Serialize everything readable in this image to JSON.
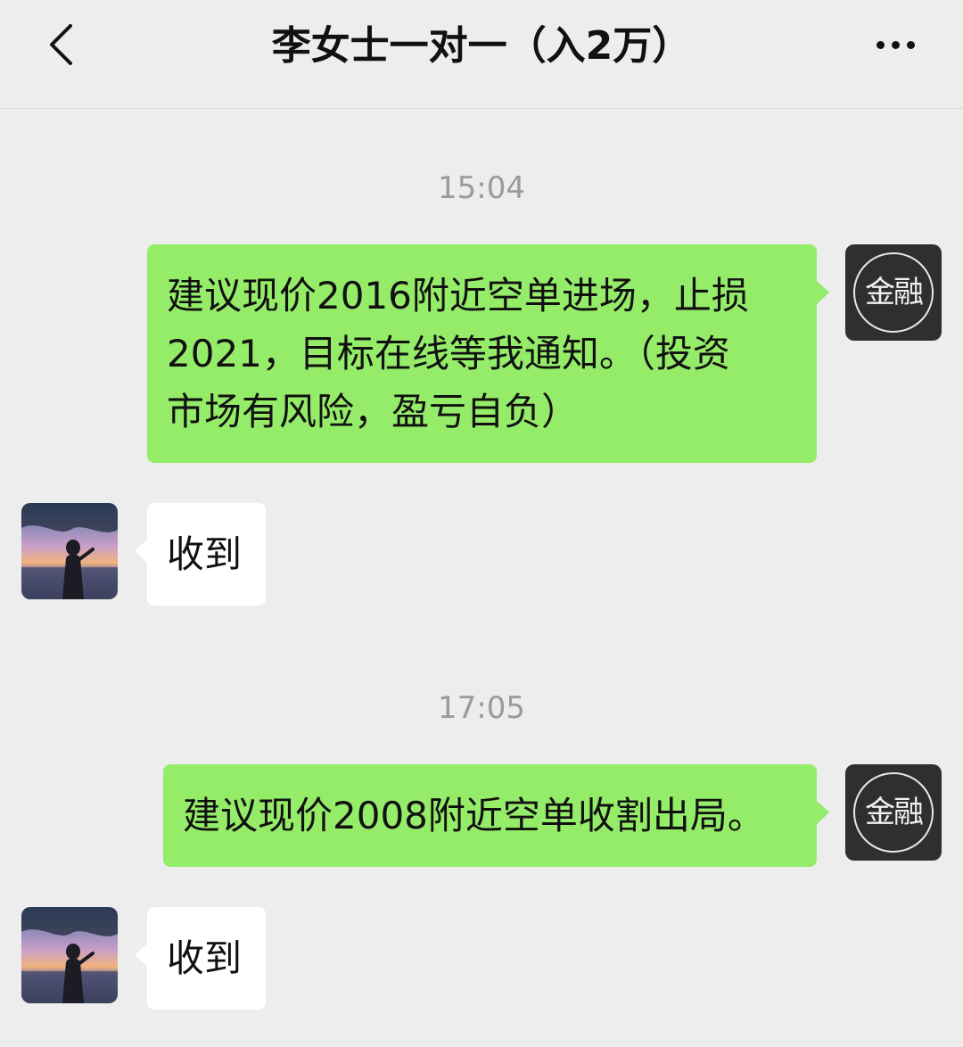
{
  "header": {
    "title": "李女士一对一（入2万）"
  },
  "colors": {
    "background": "#ededed",
    "sent_bubble": "#95ec69",
    "received_bubble": "#ffffff",
    "timestamp": "#9a9a9a"
  },
  "avatars": {
    "self_label": "金融",
    "other_icon": "sunset-silhouette-photo"
  },
  "messages": [
    {
      "time": "15:04"
    },
    {
      "direction": "sent",
      "text": "建议现价2016附近空单进场，止损\n2021，目标在线等我通知。（投资\n市场有风险，盈亏自负）"
    },
    {
      "direction": "received",
      "text": "收到"
    },
    {
      "time": "17:05"
    },
    {
      "direction": "sent",
      "text": "建议现价2008附近空单收割出局。"
    },
    {
      "direction": "received",
      "text": "收到"
    }
  ]
}
